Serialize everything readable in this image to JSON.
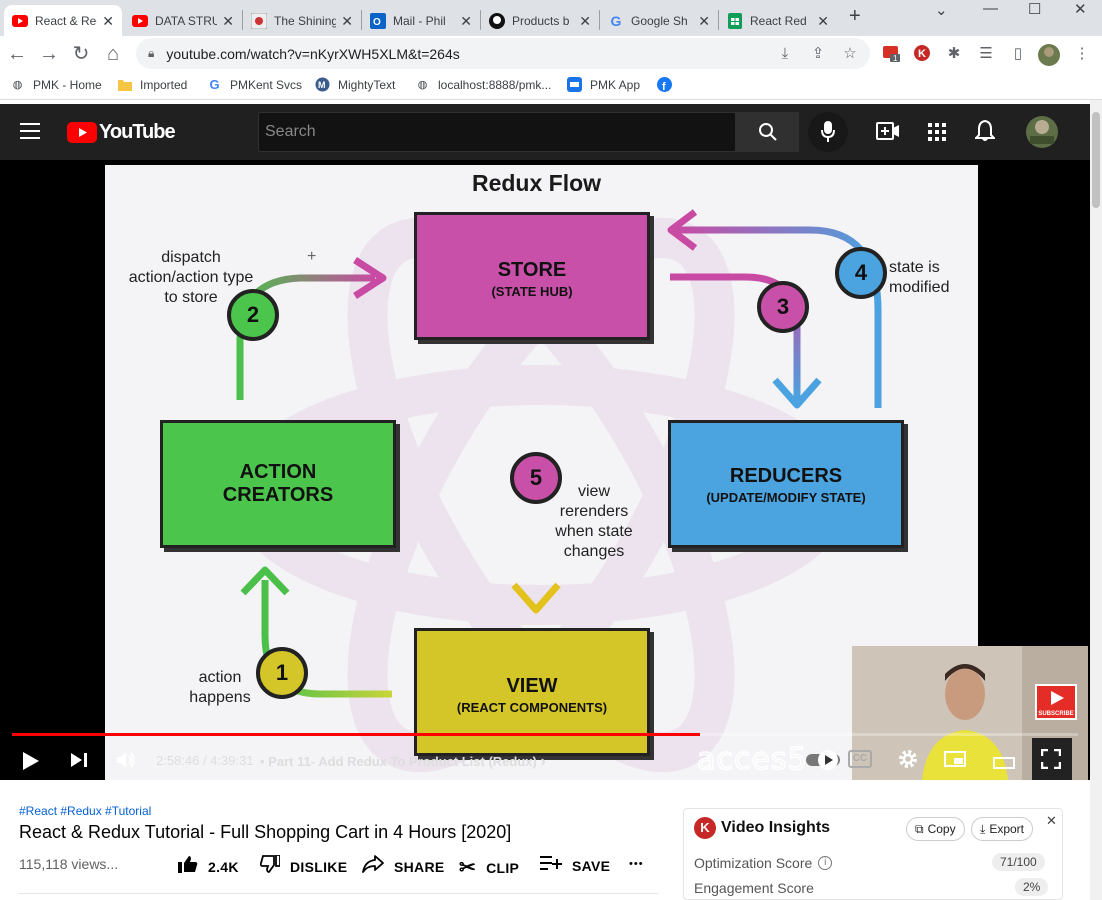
{
  "browser": {
    "tabs": [
      {
        "title": "React & Redux",
        "icon": "youtube-icon",
        "active": true
      },
      {
        "title": "DATA STRUCT",
        "icon": "youtube-icon",
        "active": false
      },
      {
        "title": "The Shining",
        "icon": "site-icon",
        "active": false
      },
      {
        "title": "Mail - Phil",
        "icon": "outlook-icon",
        "active": false
      },
      {
        "title": "Products b",
        "icon": "github-icon",
        "active": false
      },
      {
        "title": "Google Sh",
        "icon": "google-icon",
        "active": false
      },
      {
        "title": "React Red",
        "icon": "sheets-icon",
        "active": false
      }
    ],
    "new_tab": "+",
    "url": "youtube.com/watch?v=nKyrXWH5XLM&t=264s",
    "extension_badge": "1",
    "bookmarks": [
      {
        "label": "PMK - Home",
        "icon": "globe-icon"
      },
      {
        "label": "Imported",
        "icon": "folder-icon"
      },
      {
        "label": "PMKent Svcs",
        "icon": "google-icon"
      },
      {
        "label": "MightyText",
        "icon": "mightytext-icon"
      },
      {
        "label": "localhost:8888/pmk...",
        "icon": "globe-icon"
      },
      {
        "label": "PMK App",
        "icon": "app-icon"
      },
      {
        "label": "",
        "icon": "facebook-icon"
      }
    ]
  },
  "youtube": {
    "logo": "YouTube",
    "search_placeholder": "Search"
  },
  "slide": {
    "title": "Redux Flow",
    "store_title": "STORE",
    "store_sub": "(STATE HUB)",
    "action_title_1": "ACTION",
    "action_title_2": "CREATORS",
    "reducers_title": "REDUCERS",
    "reducers_sub": "(UPDATE/MODIFY STATE)",
    "view_title": "VIEW",
    "view_sub": "(REACT COMPONENTS)",
    "step1": "1",
    "step2": "2",
    "step3": "3",
    "step4": "4",
    "step5": "5",
    "ann_dispatch_1": "dispatch",
    "ann_dispatch_2": "action/action type",
    "ann_dispatch_3": "to store",
    "ann_state_1": "state is",
    "ann_state_2": "modified",
    "ann_view_1": "view",
    "ann_view_2": "rerenders",
    "ann_view_3": "when state",
    "ann_view_4": "changes",
    "ann_action_1": "action",
    "ann_action_2": "happens",
    "watermark": "acces5",
    "subscribe": "SUBSCRIBE"
  },
  "player": {
    "progress": 0.645,
    "time": "2:58:46 / 4:39:31",
    "chapter": "• Part 11- Add Redux To Product List (Redux)",
    "chapter_arrow": "›",
    "cc": "CC"
  },
  "video": {
    "hashtags": "#React #Redux #Tutorial",
    "title": "React & Redux Tutorial - Full Shopping Cart in 4 Hours [2020]",
    "views": "115,118 views...",
    "likes": "2.4K",
    "dislike": "DISLIKE",
    "share": "SHARE",
    "clip": "CLIP",
    "save": "SAVE",
    "more": "•••"
  },
  "insights": {
    "logo": "K",
    "title": "Video Insights",
    "copy": "Copy",
    "export": "Export",
    "close": "✕",
    "rows": [
      {
        "label": "Optimization Score",
        "value": "71/100"
      },
      {
        "label": "Engagement Score",
        "value": "2%"
      }
    ]
  }
}
